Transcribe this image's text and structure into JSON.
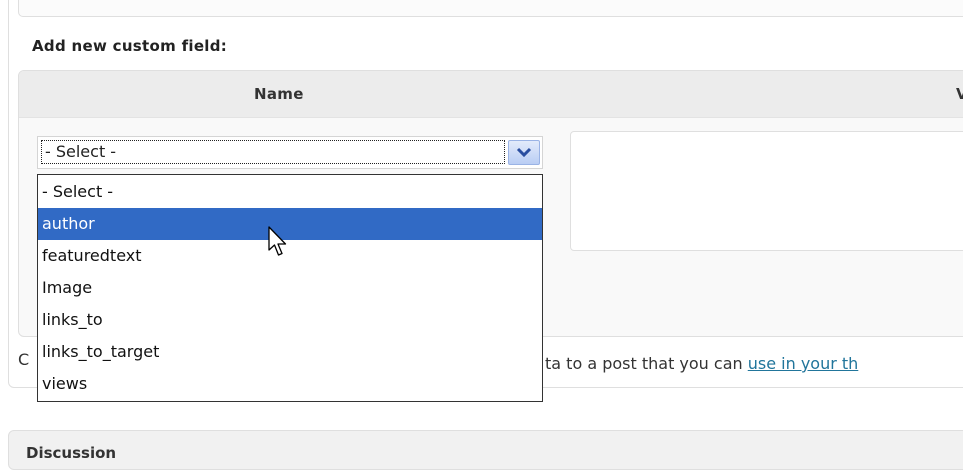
{
  "section": {
    "title": "Add new custom field:"
  },
  "table": {
    "name_header": "Name",
    "value_header": "V"
  },
  "select": {
    "current_value": "- Select -",
    "options": [
      "- Select -",
      "author",
      "featuredtext",
      "Image",
      "links_to",
      "links_to_target",
      "views"
    ],
    "highlighted_option": "author"
  },
  "help": {
    "left_fragment": "C",
    "text_fragment": "ta to a post that you can ",
    "link_text": "use in your th"
  },
  "next_box": {
    "title": "Discussion"
  },
  "icons": {
    "dropdown_arrow": "chevron-down-icon",
    "cursor": "mouse-pointer-icon"
  },
  "colors": {
    "highlight": "#316ac5",
    "link": "#21759b"
  }
}
